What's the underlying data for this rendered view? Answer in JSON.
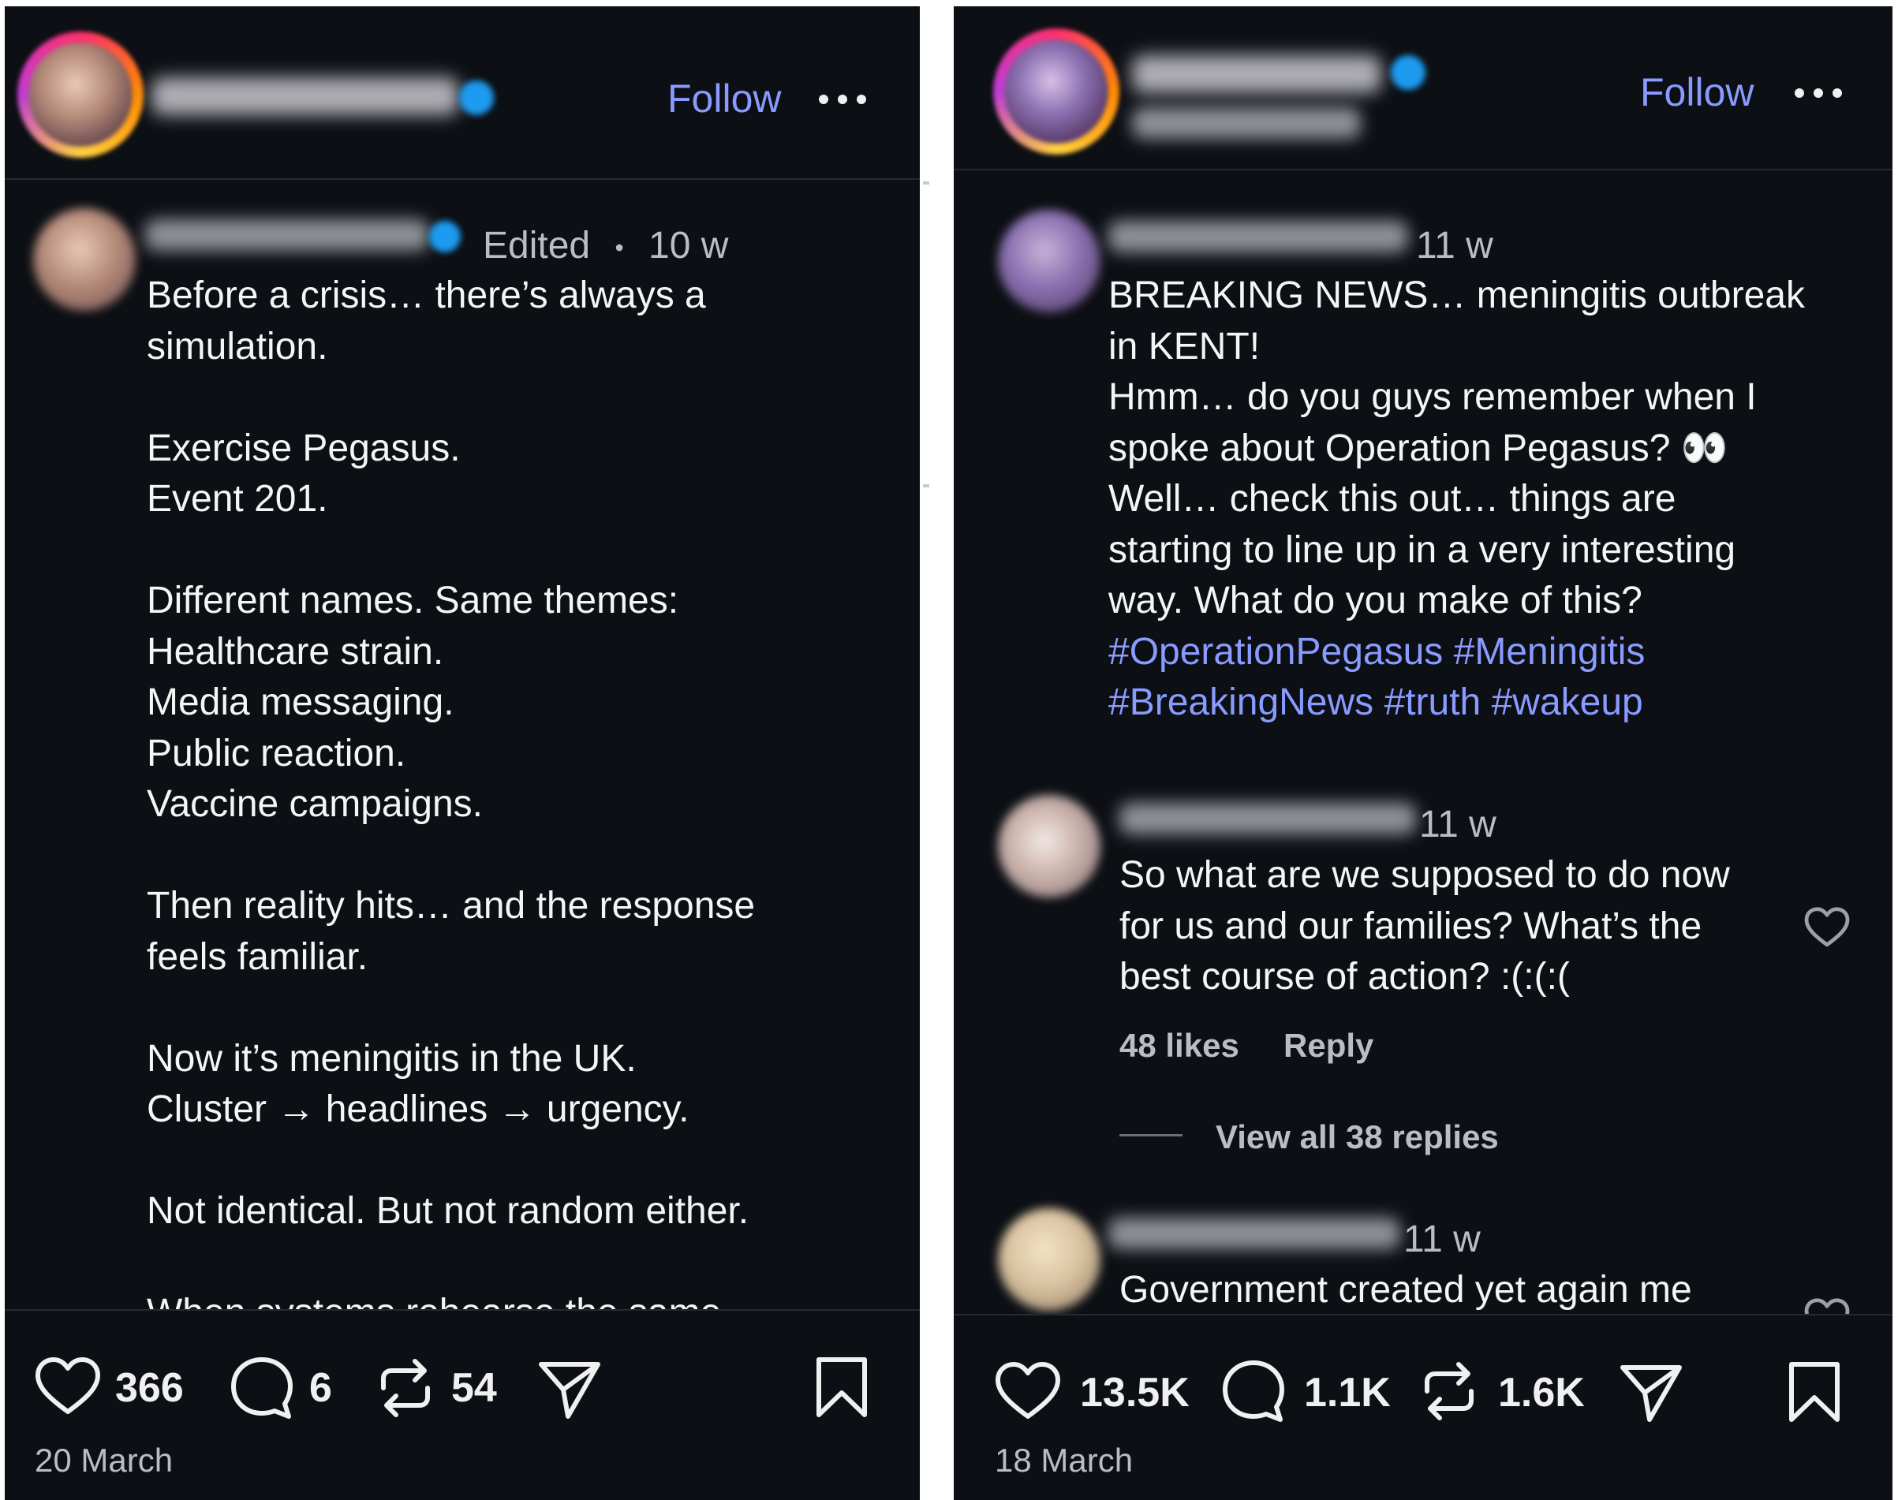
{
  "left": {
    "follow_label": "Follow",
    "post": {
      "edited_label": "Edited",
      "separator": "•",
      "time": "10 w",
      "lines": [
        "Before a crisis… there’s always a",
        "simulation.",
        "",
        "Exercise Pegasus.",
        "Event 201.",
        "",
        "Different names. Same themes:",
        "Healthcare strain.",
        "Media messaging.",
        "Public reaction.",
        "Vaccine campaigns.",
        "",
        "Then reality hits… and the response",
        "feels familiar.",
        "",
        "Now it’s meningitis in the UK.",
        "Cluster → headlines → urgency.",
        "",
        "Not identical. But not random either.",
        "",
        "When systems rehearse the same"
      ]
    },
    "actions": {
      "likes": "366",
      "comments": "6",
      "reposts": "54"
    },
    "date": "20 March"
  },
  "right": {
    "follow_label": "Follow",
    "post": {
      "time": "11 w",
      "lines": [
        "BREAKING NEWS… meningitis outbreak",
        "in KENT!",
        "Hmm… do you guys remember when I",
        "spoke about Operation Pegasus? 👀",
        "Well… check this out… things are",
        "starting to line up in a very interesting",
        "way. What do you make of this?"
      ],
      "hashtag_lines": [
        "#OperationPegasus #Meningitis",
        "#BreakingNews #truth #wakeup"
      ]
    },
    "comment1": {
      "time": "11 w",
      "lines": [
        "So what are we supposed to do now",
        "for us and our families? What’s the",
        "best course of action? :(:(:("
      ],
      "likes_label": "48 likes",
      "reply_label": "Reply",
      "view_replies_label": "View all 38 replies"
    },
    "comment2": {
      "time": "11 w",
      "lines": [
        "Government created yet again me"
      ]
    },
    "actions": {
      "likes": "13.5K",
      "comments": "1.1K",
      "reposts": "1.6K"
    },
    "date": "18 March"
  },
  "colors": {
    "background": "#0c0f14",
    "link": "#8a9bff",
    "verified": "#1d9bf0"
  },
  "icons": [
    "heart-icon",
    "comment-icon",
    "repost-icon",
    "share-icon",
    "bookmark-icon",
    "more-icon",
    "verified-icon"
  ]
}
